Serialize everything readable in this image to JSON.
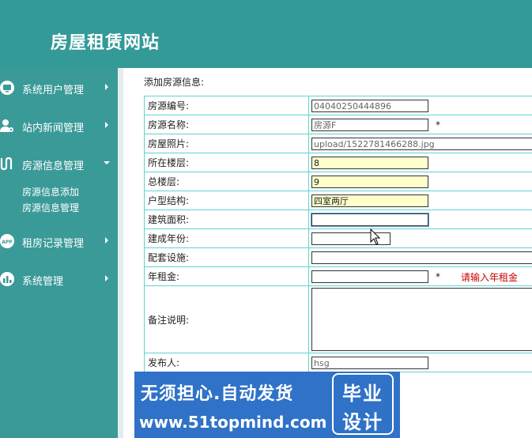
{
  "header": {
    "title": "房屋租赁网站"
  },
  "sidebar": {
    "items": [
      {
        "label": "系统用户管理",
        "icon": "monitor-icon",
        "arrow": "right"
      },
      {
        "label": "站内新闻管理",
        "icon": "user-settings-icon",
        "arrow": "right"
      },
      {
        "label": "房源信息管理",
        "icon": "route-icon",
        "arrow": "down",
        "children": [
          {
            "label": "房源信息添加"
          },
          {
            "label": "房源信息管理"
          }
        ]
      },
      {
        "label": "租房记录管理",
        "icon": "app-icon",
        "arrow": "right"
      },
      {
        "label": "系统管理",
        "icon": "bar-chart-icon",
        "arrow": "right"
      }
    ]
  },
  "form": {
    "caption": "添加房源信息:",
    "fields": [
      {
        "label": "房源编号:",
        "value": "04040250444896"
      },
      {
        "label": "房源名称:",
        "value": "房源F",
        "required": "*"
      },
      {
        "label": "房屋照片:",
        "value": "upload/1522781466288.jpg"
      },
      {
        "label": "所在楼层:",
        "value": "8"
      },
      {
        "label": "总楼层:",
        "value": "9"
      },
      {
        "label": "户型结构:",
        "value": "四室两厅"
      },
      {
        "label": "建筑面积:",
        "value": ""
      },
      {
        "label": "建成年份:",
        "value": ""
      },
      {
        "label": "配套设施:",
        "value": ""
      },
      {
        "label": "年租金:",
        "value": "",
        "required": "*",
        "hint": "请输入年租金"
      },
      {
        "label": "备注说明:",
        "value": ""
      },
      {
        "label": "发布人:",
        "value": "hsg"
      }
    ]
  },
  "banner": {
    "line1": "无须担心.自动发货",
    "line2": "www.51topmind.com",
    "badge_line1": "毕业",
    "badge_line2": "设计"
  }
}
